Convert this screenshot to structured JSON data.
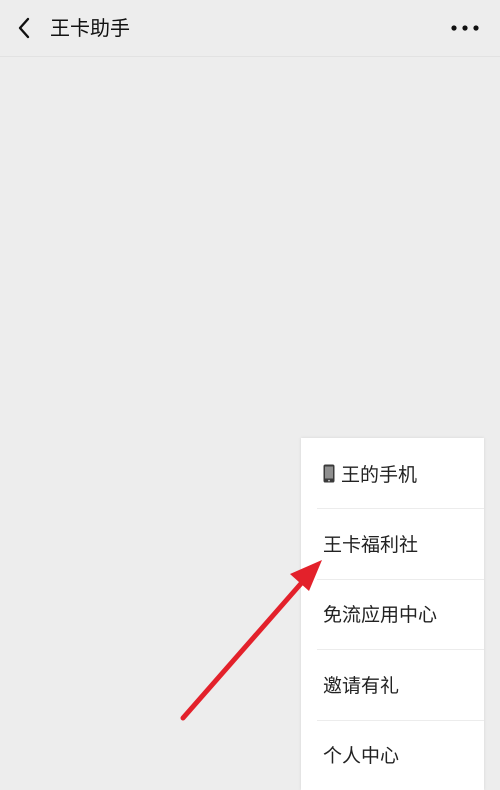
{
  "header": {
    "title": "王卡助手",
    "back_icon": "chevron-left-icon",
    "more_icon": "more-dots-icon"
  },
  "menu": {
    "items": [
      {
        "label": "王的手机",
        "icon": "phone-icon"
      },
      {
        "label": "王卡福利社"
      },
      {
        "label": "免流应用中心"
      },
      {
        "label": "邀请有礼"
      },
      {
        "label": "个人中心"
      }
    ]
  },
  "colors": {
    "background": "#ededed",
    "menu_background": "#ffffff",
    "arrow": "#e3212b"
  }
}
